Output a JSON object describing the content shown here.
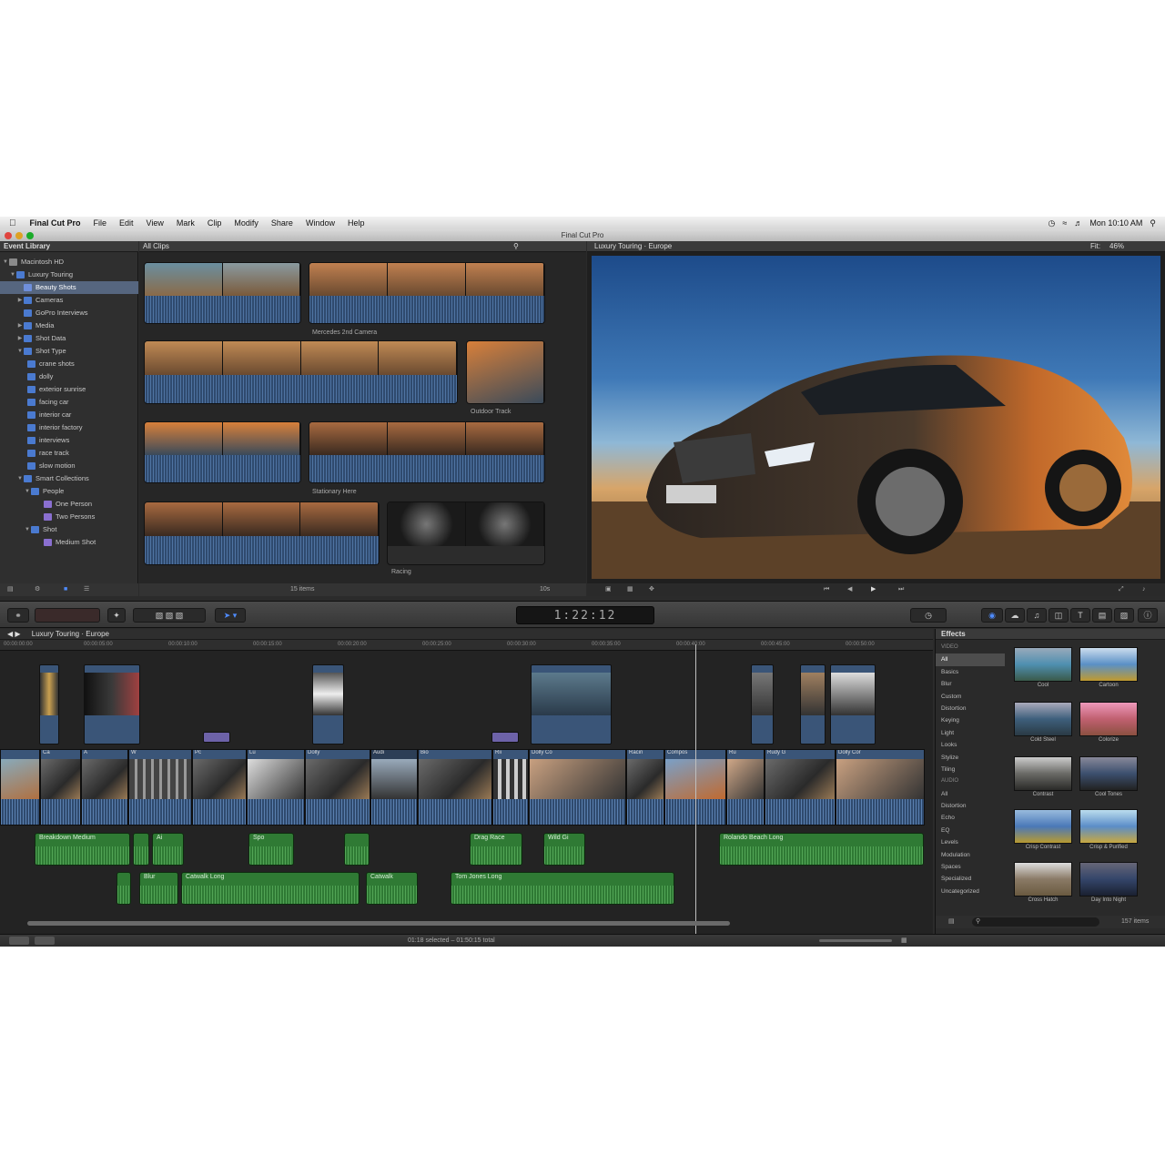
{
  "menubar": {
    "app": "Final Cut Pro",
    "items": [
      "File",
      "Edit",
      "View",
      "Mark",
      "Clip",
      "Modify",
      "Share",
      "Window",
      "Help"
    ],
    "clock": "Mon 10:10 AM"
  },
  "window": {
    "title": "Final Cut Pro"
  },
  "library": {
    "header": "Event Library",
    "items": [
      {
        "label": "Macintosh HD",
        "level": 0
      },
      {
        "label": "Luxury Touring",
        "level": 1
      },
      {
        "label": "Beauty Shots",
        "level": 2,
        "selected": true
      },
      {
        "label": "Cameras",
        "level": 2
      },
      {
        "label": "GoPro Interviews",
        "level": 2
      },
      {
        "label": "Media",
        "level": 2
      },
      {
        "label": "Shot Data",
        "level": 2
      },
      {
        "label": "Shot Type",
        "level": 2
      },
      {
        "label": "crane shots",
        "level": 3
      },
      {
        "label": "dolly",
        "level": 3
      },
      {
        "label": "exterior sunrise",
        "level": 3
      },
      {
        "label": "facing car",
        "level": 3
      },
      {
        "label": "interior car",
        "level": 3
      },
      {
        "label": "interior factory",
        "level": 3
      },
      {
        "label": "interviews",
        "level": 3
      },
      {
        "label": "race track",
        "level": 3
      },
      {
        "label": "slow motion",
        "level": 3
      },
      {
        "label": "Smart Collections",
        "level": 2
      },
      {
        "label": "People",
        "level": 3
      },
      {
        "label": "One Person",
        "level": 4
      },
      {
        "label": "Two Persons",
        "level": 4
      },
      {
        "label": "Shot",
        "level": 3
      },
      {
        "label": "Medium Shot",
        "level": 4
      }
    ]
  },
  "browser": {
    "filter": "All Clips",
    "clip_labels": [
      "Mercedes 2nd Camera",
      "Outdoor Track",
      "Stationary Here",
      "Racing"
    ],
    "item_count": "15 items",
    "zoom": "10s"
  },
  "viewer": {
    "title": "Luxury Touring · Europe",
    "fit": "Fit:",
    "zoom": "46%"
  },
  "toolbar": {
    "timecode": "1:22:12"
  },
  "timeline": {
    "title": "Luxury Touring · Europe",
    "ruler": [
      "00:00:00:00",
      "00:00:05:00",
      "00:00:10:00",
      "00:00:15:00",
      "00:00:20:00",
      "00:00:25:00",
      "00:00:30:00",
      "00:00:35:00",
      "00:00:40:00",
      "00:00:45:00",
      "00:00:50:00"
    ],
    "primary_clip_names": [
      "",
      "Ca",
      "A",
      "W",
      "Pc",
      "Lu",
      "Dolly",
      "Audi",
      "Bio",
      "Rii",
      "Dolly Co",
      "Racin",
      "Compos",
      "Ru",
      "Rudy G",
      "Dolly Cor"
    ],
    "audio_lane1": [
      "Breakdown Medium",
      "Ai",
      "Spo",
      "Drag Race",
      "Wild Gi",
      "Rolando Beach Long"
    ],
    "audio_lane2": [
      "Blur",
      "Catwalk Long",
      "Catwalk",
      "Tom Jones Long"
    ]
  },
  "effects": {
    "header": "Effects",
    "section": "VIDEO",
    "categories": [
      "All",
      "Basics",
      "Blur",
      "Custom",
      "Distortion",
      "Keying",
      "Light",
      "Looks",
      "Stylize",
      "Tiling",
      "AUDIO",
      "All",
      "Distortion",
      "Echo",
      "EQ",
      "Levels",
      "Modulation",
      "Spaces",
      "Specialized",
      "Uncategorized"
    ],
    "thumbnails": [
      {
        "label": "Cool",
        "color": "#4f8fb0"
      },
      {
        "label": "Cartoon",
        "color": "#5a90c6"
      },
      {
        "label": "Cold Steel",
        "color": "#3e5f7c"
      },
      {
        "label": "Colorize",
        "color": "#c06070"
      },
      {
        "label": "Contrast",
        "color": "#6a6a66"
      },
      {
        "label": "Cool Tones",
        "color": "#3c4f6e"
      },
      {
        "label": "Crisp Contrast",
        "color": "#4a78b8"
      },
      {
        "label": "Crisp & Purified",
        "color": "#5b8dc8"
      },
      {
        "label": "Cross Hatch",
        "color": "#8a7a66"
      },
      {
        "label": "Day Into Night",
        "color": "#34456a"
      }
    ],
    "count": "157 items"
  },
  "status": {
    "selection": "01:18 selected – 01:50:15 total"
  }
}
